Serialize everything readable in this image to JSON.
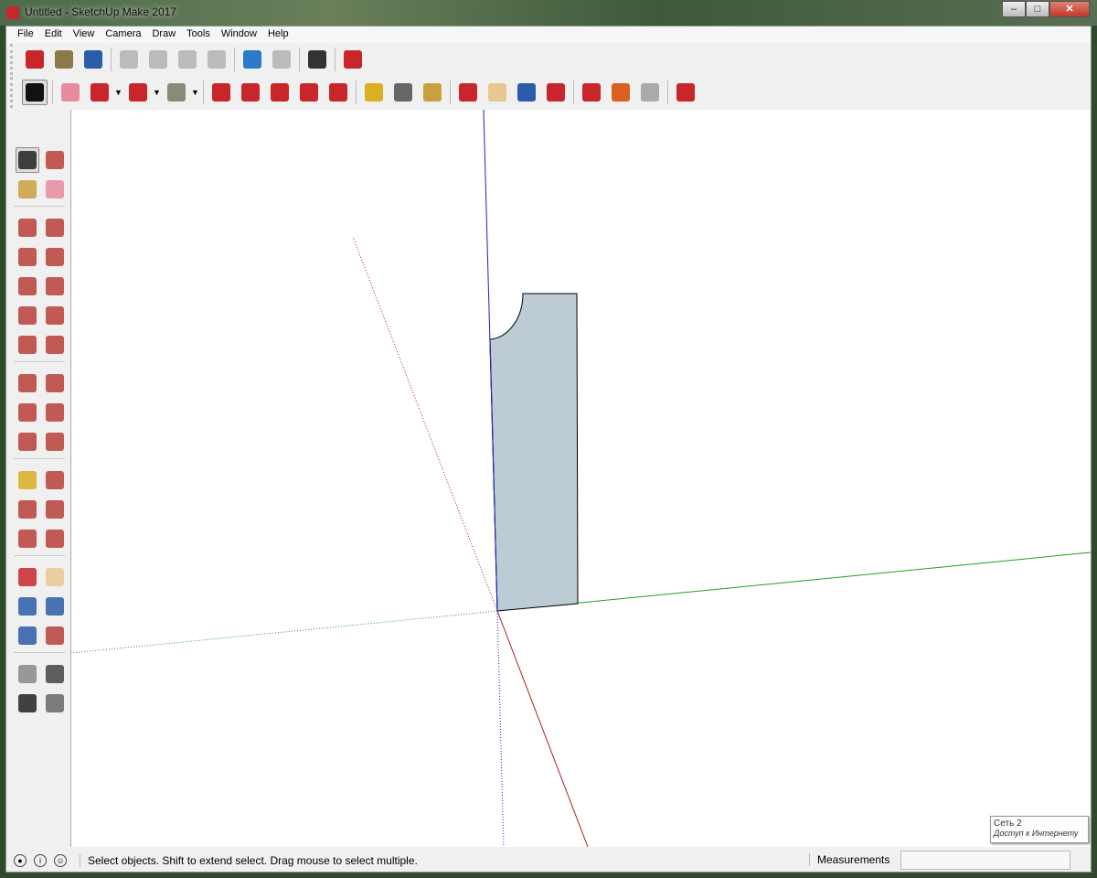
{
  "window": {
    "title": "Untitled - SketchUp Make 2017",
    "buttons": [
      "–",
      "□",
      "✕"
    ]
  },
  "menu": [
    "File",
    "Edit",
    "View",
    "Camera",
    "Draw",
    "Tools",
    "Window",
    "Help"
  ],
  "toolbar1": [
    {
      "name": "new-icon",
      "color": "#c8262a"
    },
    {
      "name": "open-icon",
      "color": "#8a7a4a"
    },
    {
      "name": "save-icon",
      "color": "#2a5ca8"
    },
    "sep",
    {
      "name": "cut-icon",
      "color": "#bbbbbb"
    },
    {
      "name": "copy-icon",
      "color": "#bbbbbb"
    },
    {
      "name": "paste-icon",
      "color": "#bbbbbb"
    },
    {
      "name": "erase-icon",
      "color": "#bbbbbb"
    },
    "sep",
    {
      "name": "undo-icon",
      "color": "#2a7ac8"
    },
    {
      "name": "redo-icon",
      "color": "#bbbbbb"
    },
    "sep",
    {
      "name": "print-icon",
      "color": "#333333"
    },
    "sep",
    {
      "name": "model-info-icon",
      "color": "#c8262a"
    }
  ],
  "toolbar2": [
    {
      "name": "select-icon",
      "color": "#111111",
      "selected": true
    },
    "sep",
    {
      "name": "eraser-icon",
      "color": "#e88aa0"
    },
    {
      "name": "pencil-icon",
      "color": "#c8262a"
    },
    "dd",
    {
      "name": "arc-icon",
      "color": "#c8262a"
    },
    "dd",
    {
      "name": "rectangle-icon",
      "color": "#8a8a7a"
    },
    "dd",
    "sep",
    {
      "name": "push-pull-icon",
      "color": "#c8262a"
    },
    {
      "name": "follow-me-icon",
      "color": "#c8262a"
    },
    {
      "name": "move-icon",
      "color": "#c8262a"
    },
    {
      "name": "rotate-icon",
      "color": "#c8262a"
    },
    {
      "name": "scale-icon",
      "color": "#c8262a"
    },
    "sep",
    {
      "name": "tape-measure-icon",
      "color": "#d8b020"
    },
    {
      "name": "text-icon",
      "color": "#666666"
    },
    {
      "name": "paint-bucket-icon",
      "color": "#c8a040"
    },
    "sep",
    {
      "name": "orbit-icon",
      "color": "#c8262a"
    },
    {
      "name": "pan-icon",
      "color": "#e8c890"
    },
    {
      "name": "zoom-icon",
      "color": "#2a5ca8"
    },
    {
      "name": "zoom-extents-icon",
      "color": "#c8262a"
    },
    "sep",
    {
      "name": "warehouse-icon",
      "color": "#c8262a"
    },
    {
      "name": "extension-icon",
      "color": "#d86020"
    },
    {
      "name": "share-model-icon",
      "color": "#aaaaaa"
    },
    "sep",
    {
      "name": "ruby-icon",
      "color": "#c8262a"
    }
  ],
  "palette": [
    [
      "select-icon",
      "make-component-icon"
    ],
    [
      "paint-bucket-icon",
      "eraser-icon"
    ],
    "gap",
    [
      "pencil-icon",
      "freehand-icon"
    ],
    [
      "rectangle-icon",
      "rotated-rectangle-icon"
    ],
    [
      "circle-icon",
      "polygon-icon"
    ],
    [
      "arc-icon",
      "two-point-arc-icon"
    ],
    [
      "three-point-arc-icon",
      "pie-icon"
    ],
    "gap",
    [
      "move-icon",
      "push-pull-icon"
    ],
    [
      "rotate-icon",
      "follow-me-icon"
    ],
    [
      "scale-icon",
      "offset-icon"
    ],
    "gap",
    [
      "tape-measure-icon",
      "dimension-icon"
    ],
    [
      "protractor-icon",
      "text-icon"
    ],
    [
      "axes-icon",
      "3d-text-icon"
    ],
    "gap",
    [
      "orbit-icon",
      "pan-icon"
    ],
    [
      "zoom-icon",
      "zoom-window-icon"
    ],
    [
      "zoom-extents-icon",
      "previous-view-icon"
    ],
    "gap",
    [
      "position-camera-icon",
      "look-around-icon"
    ],
    [
      "walk-icon",
      "section-plane-icon"
    ]
  ],
  "colors": {
    "axis_red": "#aa2020",
    "axis_green": "#20a020",
    "axis_blue": "#2020c0",
    "face": "#bccbd4"
  },
  "status": {
    "text": "Select objects. Shift to extend select. Drag mouse to select multiple.",
    "measurements_label": "Measurements",
    "measurements_value": ""
  },
  "tooltip": {
    "line1": "Сеть  2",
    "line2": "Доступ к Интернету"
  }
}
